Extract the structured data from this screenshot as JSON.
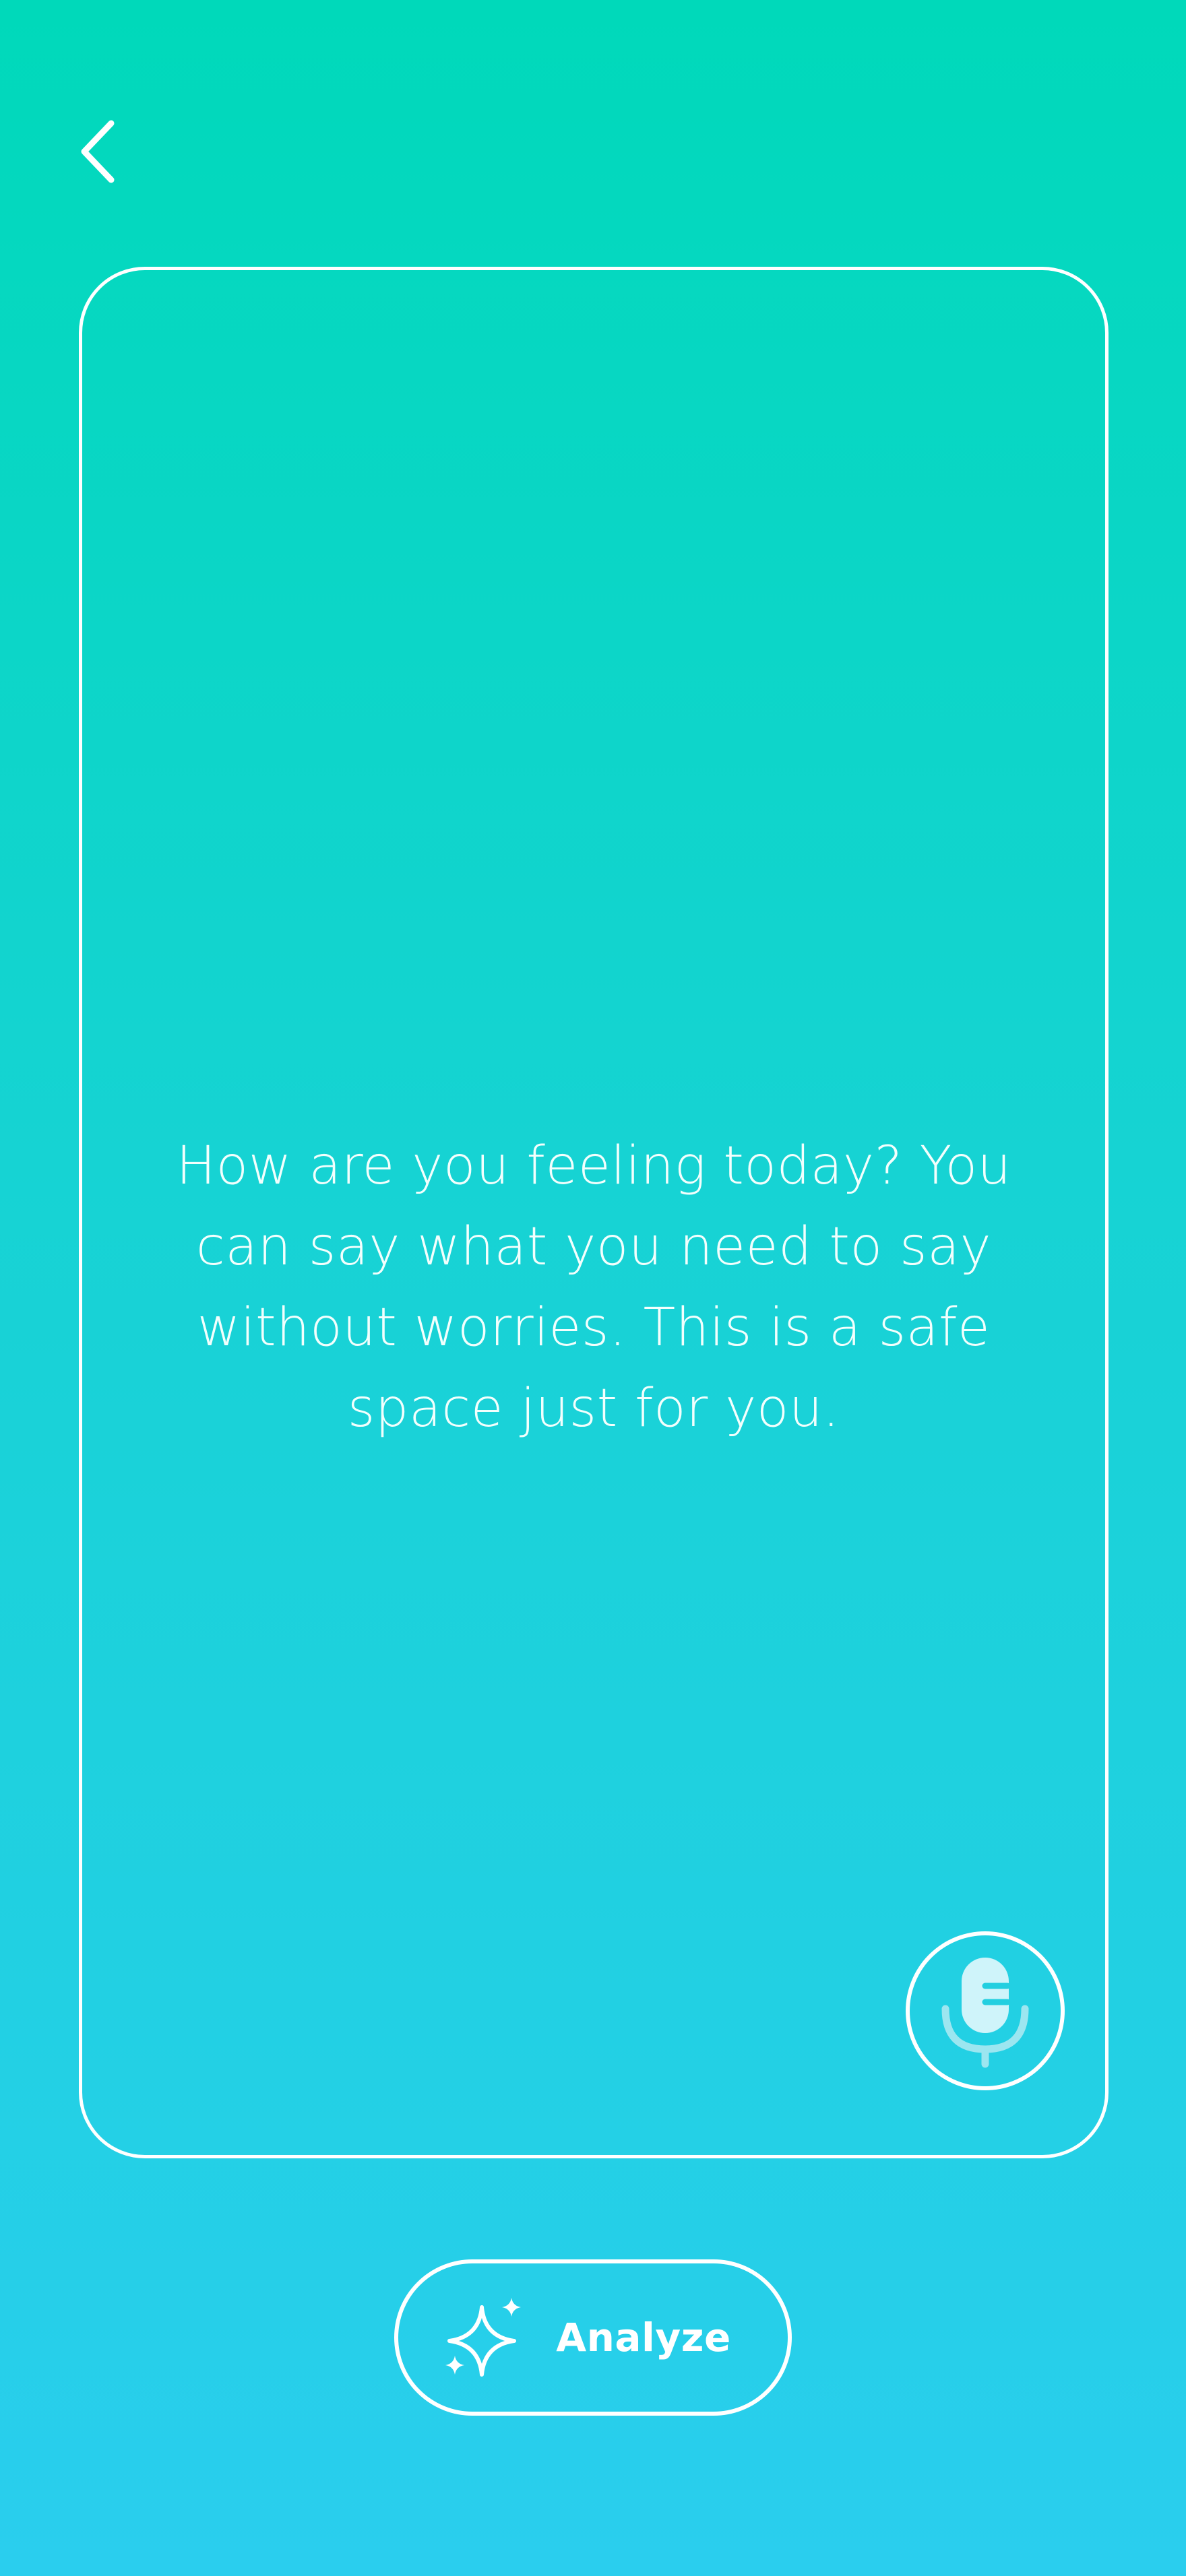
{
  "colors": {
    "gradient_top": "#00D9BA",
    "gradient_bottom": "#2ACEEE",
    "outline": "#FFFFFF",
    "mic_fill": "#CFF4FA",
    "mic_stroke": "#9CE6F0"
  },
  "icons": {
    "back": "chevron-left-icon",
    "mic": "microphone-icon",
    "analyze": "sparkles-icon"
  },
  "journal": {
    "prompt": "How are you feeling today? You can say what you need to say without worries. This is a safe space just for you."
  },
  "actions": {
    "analyze_label": "Analyze"
  }
}
